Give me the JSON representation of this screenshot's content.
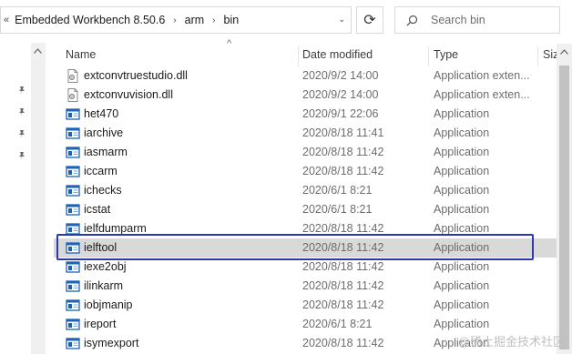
{
  "breadcrumb": {
    "lead": "«",
    "items": [
      "Embedded Workbench 8.50.6",
      "arm",
      "bin"
    ],
    "separator": "›",
    "dropdown": "⌄"
  },
  "refresh": {
    "icon": "refresh-icon",
    "glyph": "⟳"
  },
  "search": {
    "placeholder": "Search bin",
    "icon": "search-icon"
  },
  "columns": {
    "name": "Name",
    "date": "Date modified",
    "type": "Type",
    "size": "Siz"
  },
  "sort": {
    "column": "name",
    "glyph": "^"
  },
  "files": [
    {
      "name": "extconvtruestudio.dll",
      "date": "2020/9/2 14:00",
      "type": "Application exten...",
      "icon": "dll-file-icon"
    },
    {
      "name": "extconvuvision.dll",
      "date": "2020/9/2 14:00",
      "type": "Application exten...",
      "icon": "dll-file-icon"
    },
    {
      "name": "het470",
      "date": "2020/9/1 22:06",
      "type": "Application",
      "icon": "application-icon"
    },
    {
      "name": "iarchive",
      "date": "2020/8/18 11:41",
      "type": "Application",
      "icon": "application-icon"
    },
    {
      "name": "iasmarm",
      "date": "2020/8/18 11:42",
      "type": "Application",
      "icon": "application-icon"
    },
    {
      "name": "iccarm",
      "date": "2020/8/18 11:42",
      "type": "Application",
      "icon": "application-icon"
    },
    {
      "name": "ichecks",
      "date": "2020/6/1 8:21",
      "type": "Application",
      "icon": "application-icon"
    },
    {
      "name": "icstat",
      "date": "2020/6/1 8:21",
      "type": "Application",
      "icon": "application-icon"
    },
    {
      "name": "ielfdumparm",
      "date": "2020/8/18 11:42",
      "type": "Application",
      "icon": "application-icon"
    },
    {
      "name": "ielftool",
      "date": "2020/8/18 11:42",
      "type": "Application",
      "icon": "application-icon",
      "selected": true
    },
    {
      "name": "iexe2obj",
      "date": "2020/8/18 11:42",
      "type": "Application",
      "icon": "application-icon"
    },
    {
      "name": "ilinkarm",
      "date": "2020/8/18 11:42",
      "type": "Application",
      "icon": "application-icon"
    },
    {
      "name": "iobjmanip",
      "date": "2020/8/18 11:42",
      "type": "Application",
      "icon": "application-icon"
    },
    {
      "name": "ireport",
      "date": "2020/6/1 8:21",
      "type": "Application",
      "icon": "application-icon"
    },
    {
      "name": "isymexport",
      "date": "2020/8/18 11:42",
      "type": "Application",
      "icon": "application-icon"
    }
  ],
  "quick_access_pins": 4,
  "watermark": "@稀土掘金技术社区",
  "colors": {
    "selected_row": "#d9d9d9",
    "highlight_border": "#2b3aa8",
    "app_icon_blue": "#1e63b6"
  }
}
